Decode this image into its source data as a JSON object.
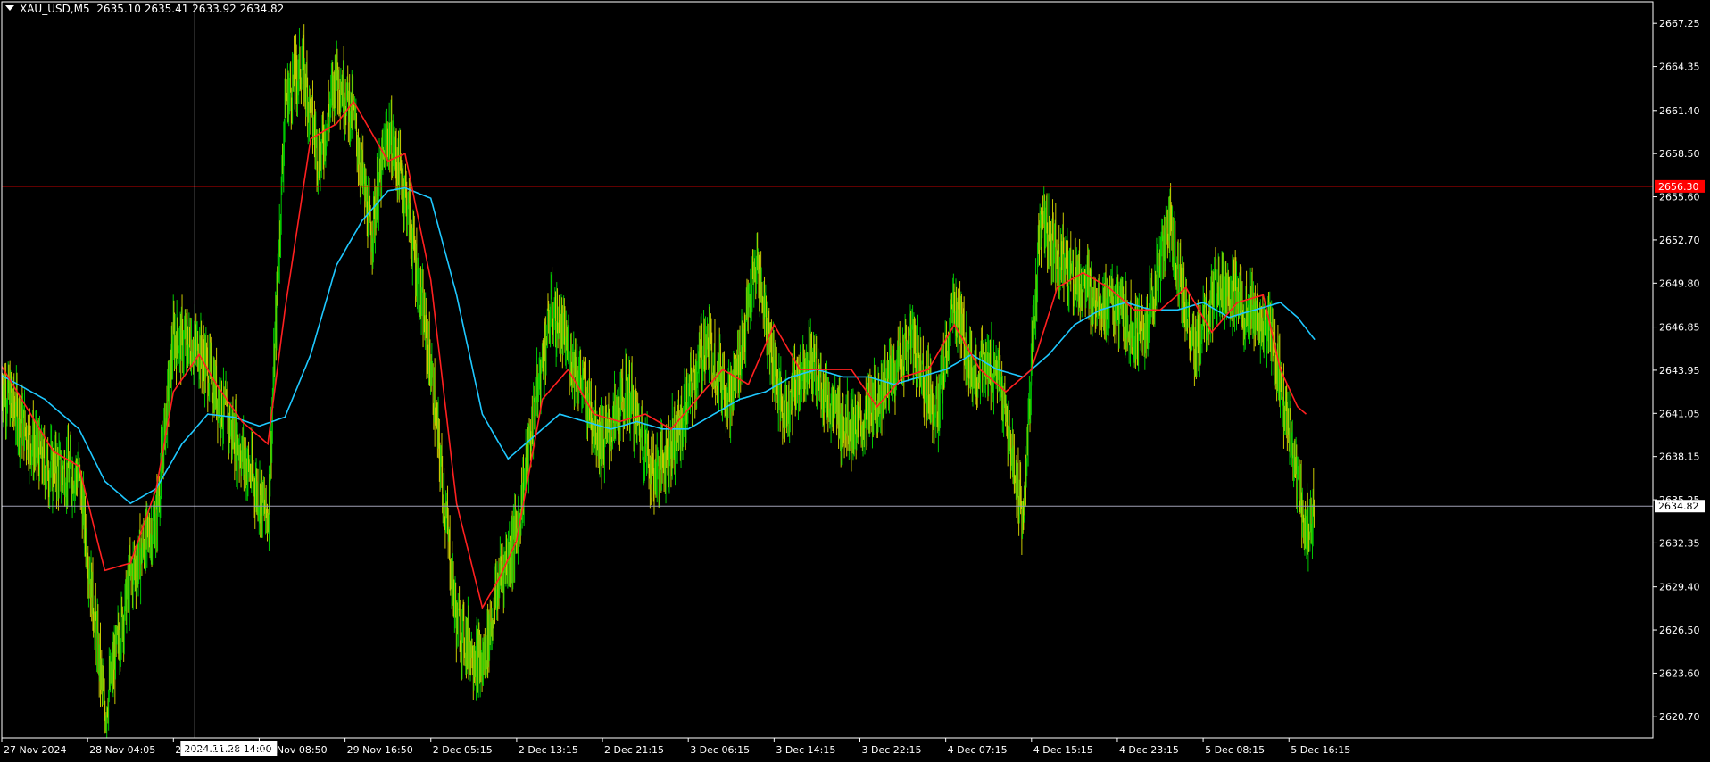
{
  "header": {
    "symbol": "XAU_USD,M5",
    "ohlc": "2635.10 2635.41 2633.92 2634.82"
  },
  "colors": {
    "background": "#000000",
    "axis": "#ffffff",
    "bull": "#00c800",
    "bear": "#c8c800",
    "ma_fast": "#ff2020",
    "ma_slow": "#1ec8ff",
    "resistance": "#ff0000",
    "bid_line": "#a0a0b4"
  },
  "chart_data": {
    "type": "line",
    "ylim": [
      2619.25,
      2668.7
    ],
    "y_ticks": [
      "2667.25",
      "2664.35",
      "2661.40",
      "2658.50",
      "2655.60",
      "2652.70",
      "2649.80",
      "2646.85",
      "2643.95",
      "2641.05",
      "2638.15",
      "2635.25",
      "2632.35",
      "2629.40",
      "2626.50",
      "2623.60",
      "2620.70"
    ],
    "x_ticks": [
      "27 Nov 2024",
      "28 Nov 04:05",
      "28 Nov 20:05",
      "29 Nov 08:50",
      "29 Nov 16:50",
      "2 Dec 05:15",
      "2 Dec 13:15",
      "2 Dec 21:15",
      "3 Dec 06:15",
      "3 Dec 14:15",
      "3 Dec 22:15",
      "4 Dec 07:15",
      "4 Dec 15:15",
      "4 Dec 23:15",
      "5 Dec 08:15",
      "5 Dec 16:15"
    ],
    "crosshair": {
      "label": "2024.11.28 14:00",
      "x_index": 2.25
    },
    "horizontal_lines": [
      {
        "value": 2656.3,
        "label": "2656.30",
        "role": "resistance"
      },
      {
        "value": 2634.82,
        "label": "2634.82",
        "role": "bid"
      }
    ],
    "series": [
      {
        "role": "price",
        "x": [
          0,
          0.5,
          0.9,
          1.2,
          1.5,
          1.8,
          2.0,
          2.3,
          2.6,
          2.9,
          3.1,
          3.3,
          3.5,
          3.7,
          3.9,
          4.1,
          4.3,
          4.5,
          4.7,
          5.0,
          5.3,
          5.6,
          5.8,
          6.0,
          6.2,
          6.4,
          6.7,
          7.0,
          7.3,
          7.6,
          7.9,
          8.2,
          8.5,
          8.8,
          9.1,
          9.4,
          9.7,
          10.0,
          10.3,
          10.6,
          10.9,
          11.1,
          11.3,
          11.6,
          11.9,
          12.1,
          12.4,
          12.7,
          13.0,
          13.3,
          13.6,
          13.9,
          14.2,
          14.5,
          14.8,
          15.0,
          15.2,
          15.3
        ],
        "values": [
          2643.0,
          2637.5,
          2637.0,
          2621.0,
          2630.0,
          2634.0,
          2646.0,
          2645.5,
          2641.0,
          2637.0,
          2634.0,
          2662.0,
          2664.5,
          2658.0,
          2664.0,
          2661.0,
          2653.0,
          2660.0,
          2656.0,
          2644.0,
          2627.0,
          2624.0,
          2630.0,
          2633.0,
          2641.0,
          2648.0,
          2644.0,
          2639.0,
          2642.5,
          2637.0,
          2640.0,
          2646.0,
          2642.0,
          2651.0,
          2641.0,
          2645.0,
          2641.0,
          2640.0,
          2643.0,
          2646.0,
          2641.0,
          2648.5,
          2644.0,
          2644.0,
          2634.0,
          2654.0,
          2651.0,
          2649.0,
          2648.0,
          2646.0,
          2654.0,
          2645.0,
          2650.0,
          2648.0,
          2646.0,
          2640.0,
          2633.0,
          2634.8
        ]
      },
      {
        "role": "ma_fast",
        "x": [
          0,
          0.6,
          0.9,
          1.2,
          1.5,
          1.8,
          2.0,
          2.3,
          2.5,
          2.8,
          3.1,
          3.3,
          3.6,
          3.9,
          4.1,
          4.3,
          4.5,
          4.7,
          5.0,
          5.3,
          5.6,
          5.8,
          6.0,
          6.3,
          6.6,
          6.9,
          7.2,
          7.5,
          7.8,
          8.1,
          8.4,
          8.7,
          9.0,
          9.3,
          9.6,
          9.9,
          10.2,
          10.5,
          10.8,
          11.1,
          11.4,
          11.7,
          12.0,
          12.3,
          12.6,
          12.9,
          13.2,
          13.5,
          13.8,
          14.1,
          14.4,
          14.7,
          14.9,
          15.1,
          15.2
        ],
        "values": [
          2644.2,
          2638.5,
          2637.5,
          2630.5,
          2631.0,
          2636.0,
          2642.5,
          2645.0,
          2643.0,
          2640.5,
          2639.0,
          2648.0,
          2659.5,
          2660.5,
          2662.0,
          2660.0,
          2658.0,
          2658.5,
          2650.0,
          2635.0,
          2628.0,
          2630.0,
          2632.5,
          2642.0,
          2644.0,
          2641.0,
          2640.5,
          2641.0,
          2640.0,
          2642.0,
          2644.0,
          2643.0,
          2647.0,
          2644.0,
          2644.0,
          2644.0,
          2641.5,
          2643.5,
          2644.0,
          2647.0,
          2644.0,
          2642.5,
          2644.0,
          2649.5,
          2650.5,
          2649.5,
          2648.0,
          2648.0,
          2649.5,
          2646.5,
          2648.5,
          2649.0,
          2644.0,
          2641.5,
          2641.0
        ]
      },
      {
        "role": "ma_slow",
        "x": [
          0,
          0.5,
          0.9,
          1.2,
          1.5,
          1.8,
          2.1,
          2.4,
          2.7,
          3.0,
          3.3,
          3.6,
          3.9,
          4.2,
          4.5,
          4.7,
          5.0,
          5.3,
          5.6,
          5.9,
          6.2,
          6.5,
          6.8,
          7.1,
          7.4,
          7.7,
          8.0,
          8.3,
          8.6,
          8.9,
          9.2,
          9.5,
          9.8,
          10.1,
          10.4,
          10.7,
          11.0,
          11.3,
          11.6,
          11.9,
          12.2,
          12.5,
          12.8,
          13.1,
          13.4,
          13.7,
          14.0,
          14.3,
          14.6,
          14.9,
          15.1,
          15.3
        ],
        "values": [
          2643.6,
          2642.0,
          2640.0,
          2636.5,
          2635.0,
          2636.0,
          2639.0,
          2641.0,
          2640.8,
          2640.2,
          2640.8,
          2645.0,
          2651.0,
          2654.0,
          2656.0,
          2656.2,
          2655.5,
          2649.0,
          2641.0,
          2638.0,
          2639.5,
          2641.0,
          2640.5,
          2640.0,
          2640.5,
          2640.0,
          2640.0,
          2641.0,
          2642.0,
          2642.5,
          2643.5,
          2644.0,
          2643.5,
          2643.5,
          2643.0,
          2643.5,
          2644.0,
          2645.0,
          2644.0,
          2643.5,
          2645.0,
          2647.0,
          2648.0,
          2648.5,
          2648.0,
          2648.0,
          2648.5,
          2647.5,
          2648.0,
          2648.5,
          2647.5,
          2646.0
        ]
      }
    ]
  }
}
